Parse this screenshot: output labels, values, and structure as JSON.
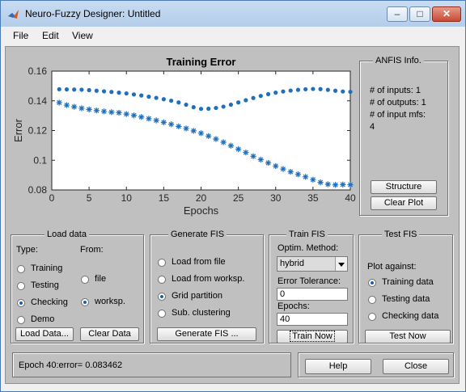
{
  "window": {
    "title": "Neuro-Fuzzy Designer: Untitled"
  },
  "menu": [
    "File",
    "Edit",
    "View"
  ],
  "chart_data": {
    "type": "scatter",
    "title": "Training Error",
    "xlabel": "Epochs",
    "ylabel": "Error",
    "xlim": [
      0,
      40
    ],
    "ylim": [
      0.08,
      0.16
    ],
    "xticks": [
      "0",
      "5",
      "10",
      "15",
      "20",
      "25",
      "30",
      "35",
      "40"
    ],
    "yticks": [
      "0.08",
      "0.1",
      "0.12",
      "0.14",
      "0.16"
    ],
    "series": [
      {
        "marker": "dot",
        "color": "#1f6fbd",
        "x": [
          1,
          2,
          3,
          4,
          5,
          6,
          7,
          8,
          9,
          10,
          11,
          12,
          13,
          14,
          15,
          16,
          17,
          18,
          19,
          20,
          21,
          22,
          23,
          24,
          25,
          26,
          27,
          28,
          29,
          30,
          31,
          32,
          33,
          34,
          35,
          36,
          37,
          38,
          39,
          40
        ],
        "y": [
          0.1478,
          0.1477,
          0.1476,
          0.1475,
          0.1472,
          0.1468,
          0.1464,
          0.146,
          0.1455,
          0.145,
          0.1443,
          0.1436,
          0.1428,
          0.142,
          0.1411,
          0.1401,
          0.1389,
          0.1374,
          0.1357,
          0.1346,
          0.1347,
          0.1352,
          0.1361,
          0.1374,
          0.1389,
          0.1404,
          0.1419,
          0.1433,
          0.1445,
          0.1455,
          0.1463,
          0.1469,
          0.1474,
          0.1478,
          0.148,
          0.1479,
          0.1474,
          0.1468,
          0.1463,
          0.1461
        ]
      },
      {
        "marker": "star",
        "color": "#1f6fbd",
        "x": [
          1,
          2,
          3,
          4,
          5,
          6,
          7,
          8,
          9,
          10,
          11,
          12,
          13,
          14,
          15,
          16,
          17,
          18,
          19,
          20,
          21,
          22,
          23,
          24,
          25,
          26,
          27,
          28,
          29,
          30,
          31,
          32,
          33,
          34,
          35,
          36,
          37,
          38,
          39,
          40
        ],
        "y": [
          0.1388,
          0.1371,
          0.136,
          0.135,
          0.1342,
          0.1335,
          0.1329,
          0.1324,
          0.132,
          0.1311,
          0.1302,
          0.1291,
          0.128,
          0.1268,
          0.1255,
          0.1242,
          0.1228,
          0.1214,
          0.1198,
          0.1182,
          0.1163,
          0.1143,
          0.1121,
          0.1098,
          0.1075,
          0.1052,
          0.1027,
          0.1004,
          0.0982,
          0.0961,
          0.0941,
          0.0922,
          0.0905,
          0.0888,
          0.0869,
          0.0851,
          0.0838,
          0.0834,
          0.0836,
          0.0835
        ]
      }
    ]
  },
  "anfis_info": {
    "title": "ANFIS Info.",
    "inputs": "# of inputs: 1",
    "outputs": "# of outputs: 1",
    "input_mfs": "# of input mfs:",
    "input_mfs_value": "4",
    "structure_btn": "Structure",
    "clear_plot_btn": "Clear Plot"
  },
  "load_data": {
    "title": "Load data",
    "type_label": "Type:",
    "from_label": "From:",
    "types": [
      {
        "label": "Training",
        "selected": false
      },
      {
        "label": "Testing",
        "selected": false
      },
      {
        "label": "Checking",
        "selected": true
      },
      {
        "label": "Demo",
        "selected": false
      }
    ],
    "sources": [
      {
        "label": "file",
        "selected": false
      },
      {
        "label": "worksp.",
        "selected": true
      }
    ],
    "load_btn": "Load Data...",
    "clear_btn": "Clear Data"
  },
  "generate_fis": {
    "title": "Generate FIS",
    "options": [
      {
        "label": "Load from file",
        "selected": false
      },
      {
        "label": "Load from worksp.",
        "selected": false
      },
      {
        "label": "Grid partition",
        "selected": true
      },
      {
        "label": "Sub. clustering",
        "selected": false
      }
    ],
    "generate_btn": "Generate FIS ..."
  },
  "train_fis": {
    "title": "Train FIS",
    "optim_label": "Optim. Method:",
    "optim_value": "hybrid",
    "tolerance_label": "Error Tolerance:",
    "tolerance_value": "0",
    "epochs_label": "Epochs:",
    "epochs_value": "40",
    "train_btn": "Train Now"
  },
  "test_fis": {
    "title": "Test FIS",
    "plot_against_label": "Plot against:",
    "options": [
      {
        "label": "Training data",
        "selected": true
      },
      {
        "label": "Testing data",
        "selected": false
      },
      {
        "label": "Checking data",
        "selected": false
      }
    ],
    "test_btn": "Test Now"
  },
  "status": {
    "text": "Epoch 40:error= 0.083462"
  },
  "footer": {
    "help_btn": "Help",
    "close_btn": "Close"
  }
}
